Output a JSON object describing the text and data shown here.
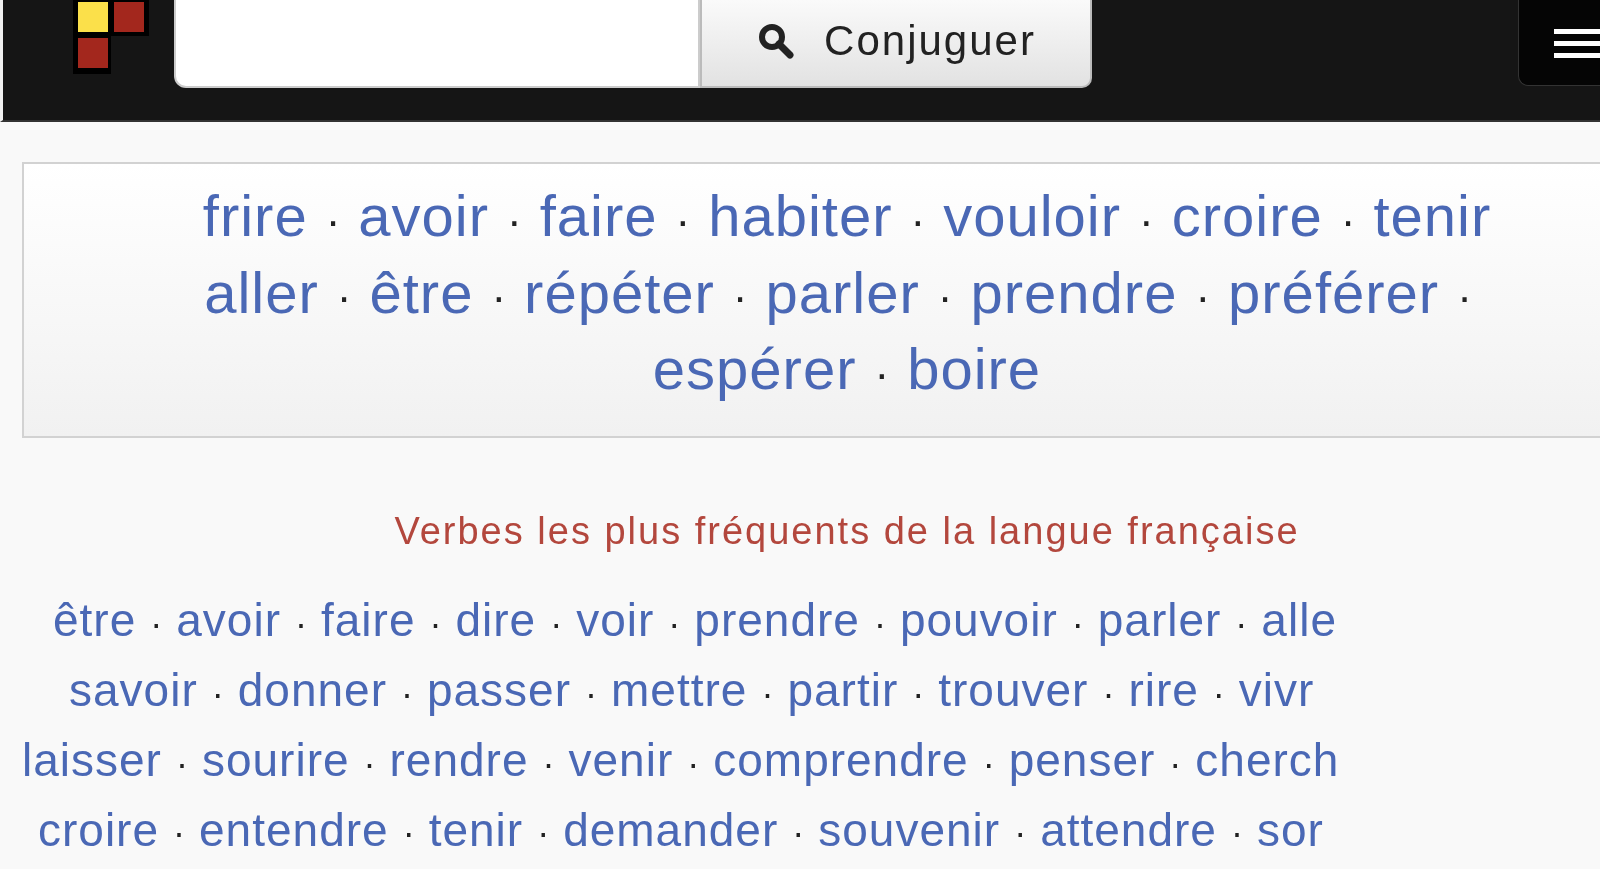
{
  "header": {
    "search_button": {
      "label": "Conjuguer"
    }
  },
  "popular_verbs": {
    "lines": [
      [
        {
          "verb": "frire",
          "sep": "·"
        },
        {
          "verb": "avoir",
          "sep": "·"
        },
        {
          "verb": "faire",
          "sep": "·"
        },
        {
          "verb": "habiter",
          "sep": "·"
        },
        {
          "verb": "vouloir",
          "sep": "·"
        },
        {
          "verb": "croire",
          "sep": "·"
        },
        {
          "verb": "tenir"
        }
      ],
      [
        {
          "verb": "aller",
          "sep": "·"
        },
        {
          "verb": "être",
          "sep": "·"
        },
        {
          "verb": "répéter",
          "sep": "·"
        },
        {
          "verb": "parler",
          "sep": "·"
        },
        {
          "verb": "prendre",
          "sep": "·"
        },
        {
          "verb": "préférer",
          "sep": "·"
        }
      ],
      [
        {
          "verb": "espérer",
          "sep": "·"
        },
        {
          "verb": "boire"
        }
      ]
    ]
  },
  "frequent_verbs": {
    "title": "Verbes les plus fréquents de la langue française",
    "lines": [
      [
        {
          "verb": "être",
          "sep": "·"
        },
        {
          "verb": "avoir",
          "sep": "·"
        },
        {
          "verb": "faire",
          "sep": "·"
        },
        {
          "verb": "dire",
          "sep": "·"
        },
        {
          "verb": "voir",
          "sep": "·"
        },
        {
          "verb": "prendre",
          "sep": "·"
        },
        {
          "verb": "pouvoir",
          "sep": "·"
        },
        {
          "verb": "parler",
          "sep": "·"
        },
        {
          "verb": "alle"
        }
      ],
      [
        {
          "verb": "savoir",
          "sep": "·"
        },
        {
          "verb": "donner",
          "sep": "·"
        },
        {
          "verb": "passer",
          "sep": "·"
        },
        {
          "verb": "mettre",
          "sep": "·"
        },
        {
          "verb": "partir",
          "sep": "·"
        },
        {
          "verb": "trouver",
          "sep": "·"
        },
        {
          "verb": "rire",
          "sep": "·"
        },
        {
          "verb": "vivr"
        }
      ],
      [
        {
          "verb": "laisser",
          "sep": "·"
        },
        {
          "verb": "sourire",
          "sep": "·"
        },
        {
          "verb": "rendre",
          "sep": "·"
        },
        {
          "verb": "venir",
          "sep": "·"
        },
        {
          "verb": "comprendre",
          "sep": "·"
        },
        {
          "verb": "penser",
          "sep": "·"
        },
        {
          "verb": "cherch"
        }
      ],
      [
        {
          "verb": "croire",
          "sep": "·"
        },
        {
          "verb": "entendre",
          "sep": "·"
        },
        {
          "verb": "tenir",
          "sep": "·"
        },
        {
          "verb": "demander",
          "sep": "·"
        },
        {
          "verb": "souvenir",
          "sep": "·"
        },
        {
          "verb": "attendre",
          "sep": "·"
        },
        {
          "verb": "sor"
        }
      ]
    ]
  }
}
